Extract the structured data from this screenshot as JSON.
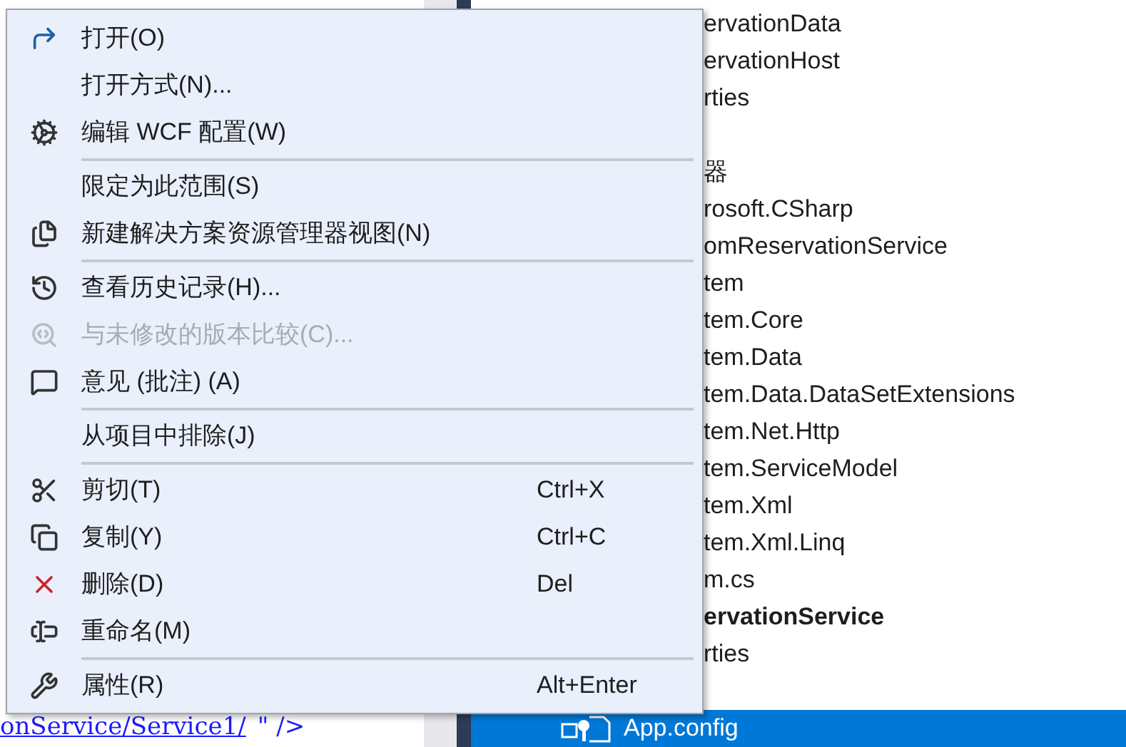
{
  "editor": {
    "link": "onService/Service1/",
    "tail": "\" />"
  },
  "explorer": {
    "rows": [
      {
        "kind": "row",
        "text": "ervationData",
        "bold": false,
        "selected": false
      },
      {
        "kind": "row",
        "text": "ervationHost",
        "bold": false,
        "selected": false
      },
      {
        "kind": "row",
        "text": "rties",
        "bold": false,
        "selected": false
      },
      {
        "kind": "blank"
      },
      {
        "kind": "row",
        "text": "器",
        "bold": false,
        "selected": false
      },
      {
        "kind": "row",
        "text": "rosoft.CSharp",
        "bold": false,
        "selected": false
      },
      {
        "kind": "row",
        "text": "omReservationService",
        "bold": false,
        "selected": false
      },
      {
        "kind": "row",
        "text": "tem",
        "bold": false,
        "selected": false
      },
      {
        "kind": "row",
        "text": "tem.Core",
        "bold": false,
        "selected": false
      },
      {
        "kind": "row",
        "text": "tem.Data",
        "bold": false,
        "selected": false
      },
      {
        "kind": "row",
        "text": "tem.Data.DataSetExtensions",
        "bold": false,
        "selected": false
      },
      {
        "kind": "row",
        "text": "tem.Net.Http",
        "bold": false,
        "selected": false
      },
      {
        "kind": "row",
        "text": "tem.ServiceModel",
        "bold": false,
        "selected": false
      },
      {
        "kind": "row",
        "text": "tem.Xml",
        "bold": false,
        "selected": false
      },
      {
        "kind": "row",
        "text": "tem.Xml.Linq",
        "bold": false,
        "selected": false
      },
      {
        "kind": "row",
        "text": "m.cs",
        "bold": false,
        "selected": false
      },
      {
        "kind": "row",
        "text": "ervationService",
        "bold": true,
        "selected": false
      },
      {
        "kind": "row",
        "text": "rties",
        "bold": false,
        "selected": false
      },
      {
        "kind": "blank"
      },
      {
        "kind": "row",
        "text": "App.config",
        "bold": false,
        "selected": true
      }
    ]
  },
  "menu": [
    {
      "kind": "item",
      "label": "打开(O)",
      "disabled": false
    },
    {
      "kind": "item",
      "label": "打开方式(N)...",
      "disabled": false
    },
    {
      "kind": "item",
      "label": "编辑 WCF 配置(W)",
      "disabled": false
    },
    {
      "kind": "separator"
    },
    {
      "kind": "item",
      "label": "限定为此范围(S)",
      "disabled": false
    },
    {
      "kind": "item",
      "label": "新建解决方案资源管理器视图(N)",
      "disabled": false
    },
    {
      "kind": "separator"
    },
    {
      "kind": "item",
      "label": "查看历史记录(H)...",
      "disabled": false
    },
    {
      "kind": "item",
      "label": "与未修改的版本比较(C)...",
      "disabled": true
    },
    {
      "kind": "item",
      "label": "意见 (批注) (A)",
      "disabled": false
    },
    {
      "kind": "separator"
    },
    {
      "kind": "item",
      "label": "从项目中排除(J)",
      "disabled": false
    },
    {
      "kind": "separator"
    },
    {
      "kind": "item",
      "label": "剪切(T)",
      "shortcut": "Ctrl+X",
      "disabled": false
    },
    {
      "kind": "item",
      "label": "复制(Y)",
      "shortcut": "Ctrl+C",
      "disabled": false
    },
    {
      "kind": "item",
      "label": "删除(D)",
      "shortcut": "Del",
      "disabled": false
    },
    {
      "kind": "item",
      "label": "重命名(M)",
      "disabled": false
    },
    {
      "kind": "separator"
    },
    {
      "kind": "item",
      "label": "属性(R)",
      "shortcut": "Alt+Enter",
      "disabled": false
    }
  ]
}
